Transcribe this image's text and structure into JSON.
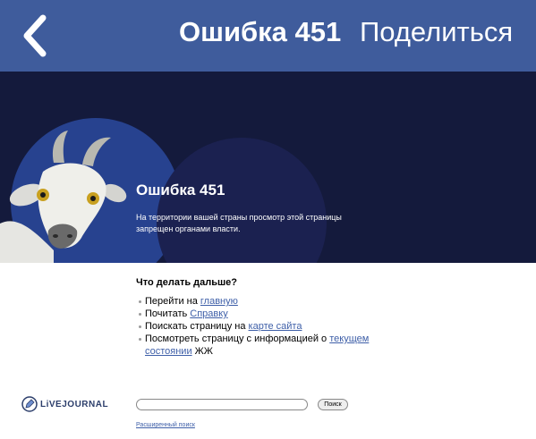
{
  "topbar": {
    "title": "Ошибка 451",
    "share_label": "Поделиться",
    "bg_color": "#3f5c9c"
  },
  "banner": {
    "title": "Ошибка 451",
    "text": "На территории вашей страны просмотр этой страницы запрещен органами власти.",
    "bg_color": "#141a3c"
  },
  "content": {
    "heading": "Что делать дальше?",
    "items": [
      {
        "prefix": "Перейти на ",
        "link": "главную",
        "suffix": ""
      },
      {
        "prefix": "Почитать ",
        "link": "Справку",
        "suffix": ""
      },
      {
        "prefix": "Поискать страницу на ",
        "link": "карте сайта",
        "suffix": ""
      },
      {
        "prefix": "Посмотреть страницу с информацией о ",
        "link": "текущем состоянии",
        "suffix": " ЖЖ"
      }
    ]
  },
  "logo": {
    "text": "LiVEJOURNAL"
  },
  "search": {
    "value": "",
    "button_label": "Поиск",
    "advanced_label": "Расширенный поиск"
  },
  "icons": {
    "back": "chevron-left-icon",
    "logo": "livejournal-pencil-icon",
    "goat": "goat-illustration"
  },
  "link_color": "#3e5fa8"
}
